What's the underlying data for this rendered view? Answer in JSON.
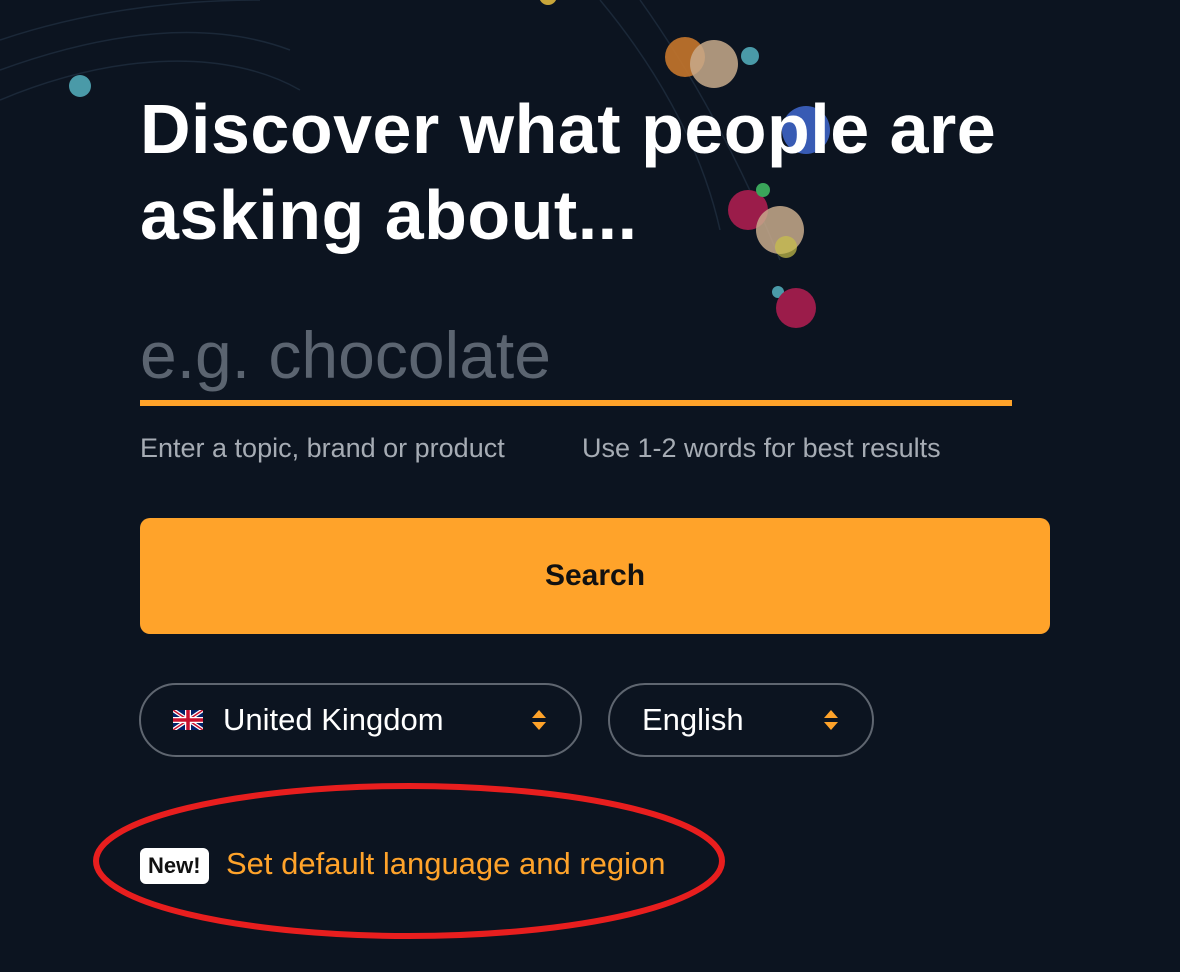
{
  "colors": {
    "background": "#0c1420",
    "accent": "#ffa32a",
    "headline": "#ffffff",
    "hint_text": "#a6acb4",
    "placeholder": "#5b6470",
    "annotation": "#e81e1e"
  },
  "headline": "Discover what people are asking about...",
  "search": {
    "placeholder": "e.g. chocolate",
    "value": "",
    "hint_left": "Enter a topic, brand or product",
    "hint_right": "Use 1-2 words for best results",
    "button_label": "Search"
  },
  "filters": {
    "country": {
      "selected": "United Kingdom",
      "flag_icon": "uk-flag-icon"
    },
    "language": {
      "selected": "English"
    }
  },
  "promo": {
    "badge": "New!",
    "link_label": "Set default language and region"
  },
  "annotation": {
    "shape": "ellipse",
    "color": "#e81e1e",
    "target": "promo"
  }
}
